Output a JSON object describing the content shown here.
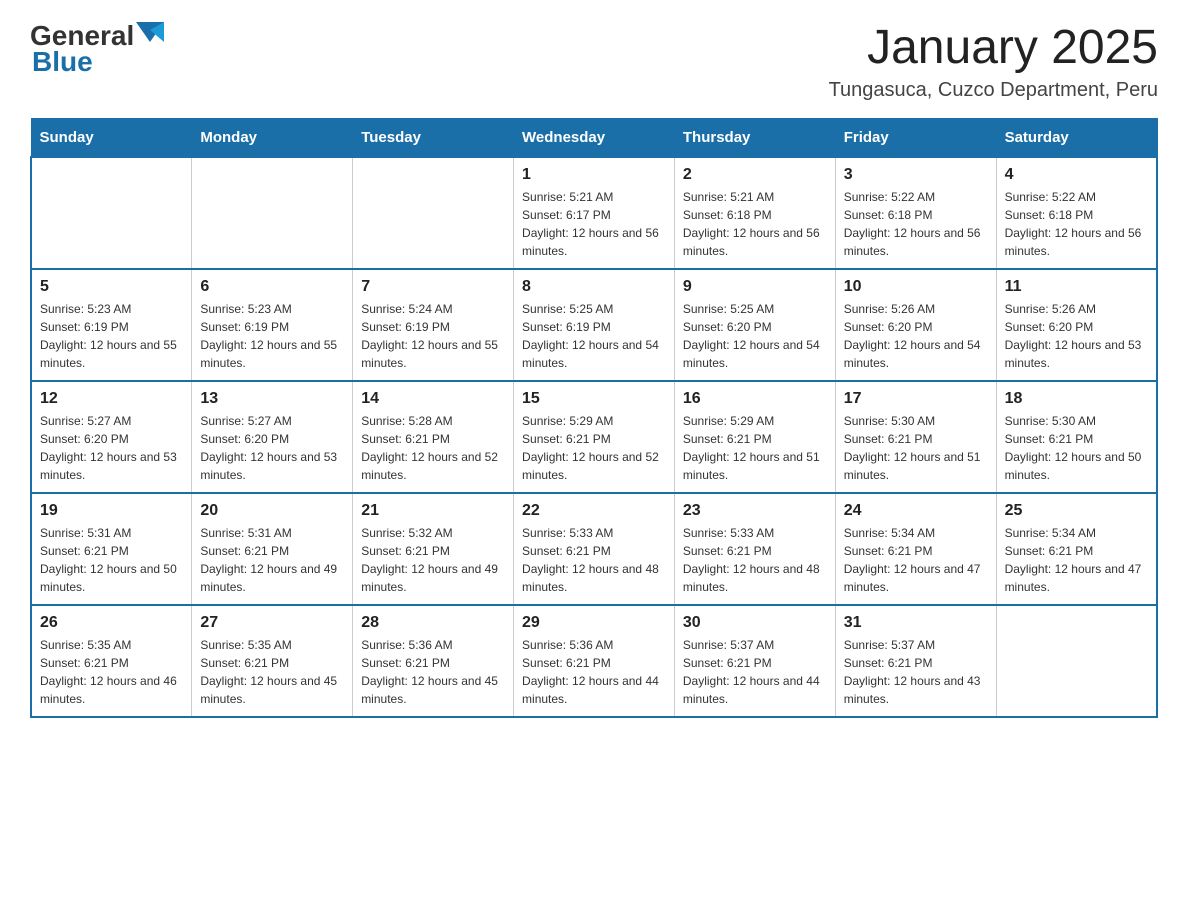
{
  "header": {
    "logo_general": "General",
    "logo_blue": "Blue",
    "title": "January 2025",
    "subtitle": "Tungasuca, Cuzco Department, Peru"
  },
  "days_of_week": [
    "Sunday",
    "Monday",
    "Tuesday",
    "Wednesday",
    "Thursday",
    "Friday",
    "Saturday"
  ],
  "weeks": [
    {
      "days": [
        {
          "number": "",
          "info": ""
        },
        {
          "number": "",
          "info": ""
        },
        {
          "number": "",
          "info": ""
        },
        {
          "number": "1",
          "info": "Sunrise: 5:21 AM\nSunset: 6:17 PM\nDaylight: 12 hours and 56 minutes."
        },
        {
          "number": "2",
          "info": "Sunrise: 5:21 AM\nSunset: 6:18 PM\nDaylight: 12 hours and 56 minutes."
        },
        {
          "number": "3",
          "info": "Sunrise: 5:22 AM\nSunset: 6:18 PM\nDaylight: 12 hours and 56 minutes."
        },
        {
          "number": "4",
          "info": "Sunrise: 5:22 AM\nSunset: 6:18 PM\nDaylight: 12 hours and 56 minutes."
        }
      ]
    },
    {
      "days": [
        {
          "number": "5",
          "info": "Sunrise: 5:23 AM\nSunset: 6:19 PM\nDaylight: 12 hours and 55 minutes."
        },
        {
          "number": "6",
          "info": "Sunrise: 5:23 AM\nSunset: 6:19 PM\nDaylight: 12 hours and 55 minutes."
        },
        {
          "number": "7",
          "info": "Sunrise: 5:24 AM\nSunset: 6:19 PM\nDaylight: 12 hours and 55 minutes."
        },
        {
          "number": "8",
          "info": "Sunrise: 5:25 AM\nSunset: 6:19 PM\nDaylight: 12 hours and 54 minutes."
        },
        {
          "number": "9",
          "info": "Sunrise: 5:25 AM\nSunset: 6:20 PM\nDaylight: 12 hours and 54 minutes."
        },
        {
          "number": "10",
          "info": "Sunrise: 5:26 AM\nSunset: 6:20 PM\nDaylight: 12 hours and 54 minutes."
        },
        {
          "number": "11",
          "info": "Sunrise: 5:26 AM\nSunset: 6:20 PM\nDaylight: 12 hours and 53 minutes."
        }
      ]
    },
    {
      "days": [
        {
          "number": "12",
          "info": "Sunrise: 5:27 AM\nSunset: 6:20 PM\nDaylight: 12 hours and 53 minutes."
        },
        {
          "number": "13",
          "info": "Sunrise: 5:27 AM\nSunset: 6:20 PM\nDaylight: 12 hours and 53 minutes."
        },
        {
          "number": "14",
          "info": "Sunrise: 5:28 AM\nSunset: 6:21 PM\nDaylight: 12 hours and 52 minutes."
        },
        {
          "number": "15",
          "info": "Sunrise: 5:29 AM\nSunset: 6:21 PM\nDaylight: 12 hours and 52 minutes."
        },
        {
          "number": "16",
          "info": "Sunrise: 5:29 AM\nSunset: 6:21 PM\nDaylight: 12 hours and 51 minutes."
        },
        {
          "number": "17",
          "info": "Sunrise: 5:30 AM\nSunset: 6:21 PM\nDaylight: 12 hours and 51 minutes."
        },
        {
          "number": "18",
          "info": "Sunrise: 5:30 AM\nSunset: 6:21 PM\nDaylight: 12 hours and 50 minutes."
        }
      ]
    },
    {
      "days": [
        {
          "number": "19",
          "info": "Sunrise: 5:31 AM\nSunset: 6:21 PM\nDaylight: 12 hours and 50 minutes."
        },
        {
          "number": "20",
          "info": "Sunrise: 5:31 AM\nSunset: 6:21 PM\nDaylight: 12 hours and 49 minutes."
        },
        {
          "number": "21",
          "info": "Sunrise: 5:32 AM\nSunset: 6:21 PM\nDaylight: 12 hours and 49 minutes."
        },
        {
          "number": "22",
          "info": "Sunrise: 5:33 AM\nSunset: 6:21 PM\nDaylight: 12 hours and 48 minutes."
        },
        {
          "number": "23",
          "info": "Sunrise: 5:33 AM\nSunset: 6:21 PM\nDaylight: 12 hours and 48 minutes."
        },
        {
          "number": "24",
          "info": "Sunrise: 5:34 AM\nSunset: 6:21 PM\nDaylight: 12 hours and 47 minutes."
        },
        {
          "number": "25",
          "info": "Sunrise: 5:34 AM\nSunset: 6:21 PM\nDaylight: 12 hours and 47 minutes."
        }
      ]
    },
    {
      "days": [
        {
          "number": "26",
          "info": "Sunrise: 5:35 AM\nSunset: 6:21 PM\nDaylight: 12 hours and 46 minutes."
        },
        {
          "number": "27",
          "info": "Sunrise: 5:35 AM\nSunset: 6:21 PM\nDaylight: 12 hours and 45 minutes."
        },
        {
          "number": "28",
          "info": "Sunrise: 5:36 AM\nSunset: 6:21 PM\nDaylight: 12 hours and 45 minutes."
        },
        {
          "number": "29",
          "info": "Sunrise: 5:36 AM\nSunset: 6:21 PM\nDaylight: 12 hours and 44 minutes."
        },
        {
          "number": "30",
          "info": "Sunrise: 5:37 AM\nSunset: 6:21 PM\nDaylight: 12 hours and 44 minutes."
        },
        {
          "number": "31",
          "info": "Sunrise: 5:37 AM\nSunset: 6:21 PM\nDaylight: 12 hours and 43 minutes."
        },
        {
          "number": "",
          "info": ""
        }
      ]
    }
  ]
}
